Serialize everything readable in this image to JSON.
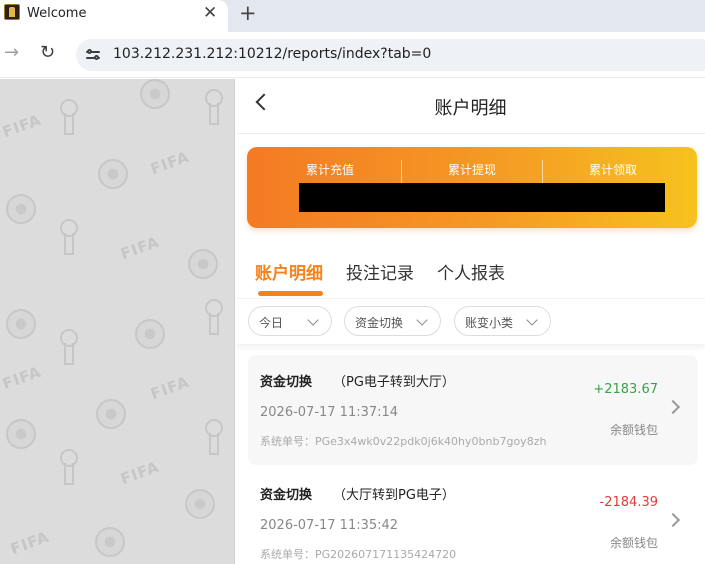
{
  "browser": {
    "tab_title": "Welcome",
    "close_glyph": "✕",
    "new_tab_glyph": "+",
    "url": "103.212.231.212:10212/reports/index?tab=0"
  },
  "header": {
    "title": "账户明细"
  },
  "summary": {
    "recharge_label": "累计充值",
    "withdraw_label": "累计提现",
    "claim_label": "累计领取"
  },
  "tabs": [
    {
      "label": "账户明细",
      "active": true
    },
    {
      "label": "投注记录",
      "active": false
    },
    {
      "label": "个人报表",
      "active": false
    }
  ],
  "filters": [
    {
      "label": "今日"
    },
    {
      "label": "资金切换"
    },
    {
      "label": "账变小类"
    }
  ],
  "records": [
    {
      "type": "资金切换",
      "detail": "（PG电子转到大厅）",
      "time": "2026-07-17 11:37:14",
      "order": "系统单号：PGe3x4wk0v22pdk0j6k40hy0bnb7goy8zh",
      "amount": "+2183.67",
      "wallet": "余额钱包"
    },
    {
      "type": "资金切换",
      "detail": "（大厅转到PG电子）",
      "time": "2026-07-17 11:35:42",
      "order": "系统单号：PG202607171135424720",
      "amount": "-2184.39",
      "wallet": "余额钱包"
    }
  ],
  "colors": {
    "accent": "#f7821c",
    "positive": "#3aa14a",
    "negative": "#e23b3b"
  }
}
